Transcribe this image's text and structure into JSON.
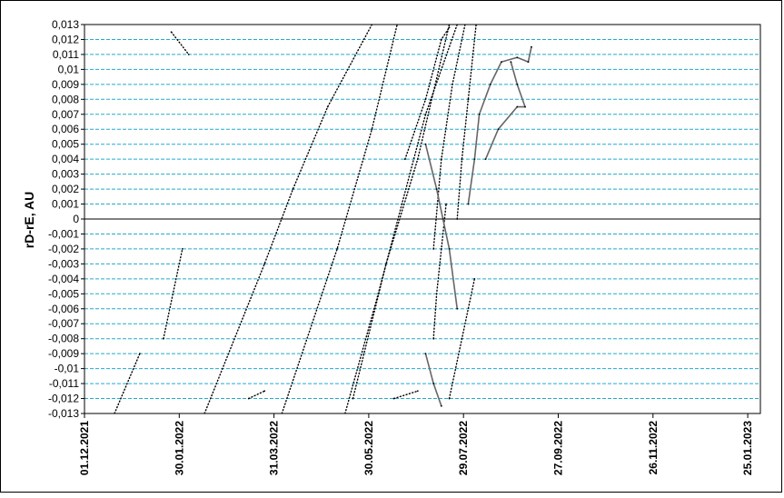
{
  "chart_data": {
    "type": "scatter",
    "title": "",
    "xlabel": "",
    "ylabel": "rD-rE, AU",
    "ylim": [
      -0.013,
      0.013
    ],
    "xlim": [
      "2021-12-01",
      "2023-02-02"
    ],
    "y_ticks": [
      "0,013",
      "0,012",
      "0,011",
      "0,01",
      "0,009",
      "0,008",
      "0,007",
      "0,006",
      "0,005",
      "0,004",
      "0,003",
      "0,002",
      "0,001",
      "0",
      "-0,001",
      "-0,002",
      "-0,003",
      "-0,004",
      "-0,005",
      "-0,006",
      "-0,007",
      "-0,008",
      "-0,009",
      "-0,01",
      "-0,011",
      "-0,012",
      "-0,013"
    ],
    "x_ticks": [
      {
        "date": "2021-12-01",
        "label": "01.12.2021"
      },
      {
        "date": "2022-01-30",
        "label": "30.01.2022"
      },
      {
        "date": "2022-03-31",
        "label": "31.03.2022"
      },
      {
        "date": "2022-05-30",
        "label": "30.05.2022"
      },
      {
        "date": "2022-07-29",
        "label": "29.07.2022"
      },
      {
        "date": "2022-09-27",
        "label": "27.09.2022"
      },
      {
        "date": "2022-11-26",
        "label": "26.11.2022"
      },
      {
        "date": "2023-01-25",
        "label": "25.01.2023"
      }
    ],
    "grid": "horizontal dashed",
    "legend": "none",
    "colors": {
      "grid": "#22aacc",
      "points": "#000000",
      "zero_line": "#000000",
      "curve": "#666666"
    },
    "series": [
      {
        "points": [
          [
            "2021-12-20",
            -0.013
          ],
          [
            "2022-01-05",
            -0.009
          ]
        ]
      },
      {
        "points": [
          [
            "2022-01-20",
            -0.008
          ],
          [
            "2022-02-01",
            -0.002
          ]
        ]
      },
      {
        "points": [
          [
            "2022-02-15",
            -0.013
          ],
          [
            "2022-03-25",
            -0.003
          ],
          [
            "2022-04-12",
            0.002
          ],
          [
            "2022-05-04",
            0.0075
          ],
          [
            "2022-06-01",
            0.013
          ]
        ]
      },
      {
        "points": [
          [
            "2022-04-05",
            -0.013
          ],
          [
            "2022-05-10",
            -0.002
          ],
          [
            "2022-06-01",
            0.006
          ],
          [
            "2022-06-17",
            0.013
          ]
        ]
      },
      {
        "points": [
          [
            "2022-05-15",
            -0.013
          ],
          [
            "2022-06-05",
            -0.005
          ],
          [
            "2022-06-20",
            0.001
          ],
          [
            "2022-07-05",
            0.007
          ],
          [
            "2022-07-25",
            0.013
          ]
        ]
      },
      {
        "points": [
          [
            "2022-05-20",
            -0.012
          ],
          [
            "2022-06-10",
            -0.003
          ],
          [
            "2022-06-30",
            0.004
          ],
          [
            "2022-07-20",
            0.013
          ]
        ]
      },
      {
        "points": [
          [
            "2022-06-22",
            0.004
          ],
          [
            "2022-07-05",
            0.008
          ],
          [
            "2022-07-15",
            0.012
          ],
          [
            "2022-07-20",
            0.0128
          ]
        ]
      },
      {
        "points": [
          [
            "2022-07-10",
            -0.002
          ],
          [
            "2022-07-15",
            0.004
          ],
          [
            "2022-07-22",
            0.009
          ],
          [
            "2022-07-30",
            0.013
          ]
        ]
      },
      {
        "points": [
          [
            "2022-07-25",
            0.0
          ],
          [
            "2022-07-28",
            0.004
          ],
          [
            "2022-08-01",
            0.008
          ],
          [
            "2022-08-06",
            0.013
          ]
        ]
      },
      {
        "points": [
          [
            "2022-06-15",
            -0.012
          ],
          [
            "2022-06-30",
            -0.0115
          ]
        ]
      },
      {
        "points": [
          [
            "2022-03-15",
            -0.012
          ],
          [
            "2022-03-25",
            -0.0115
          ]
        ]
      },
      {
        "points": [
          [
            "2022-01-25",
            0.0125
          ],
          [
            "2022-02-05",
            0.011
          ]
        ]
      },
      {
        "points": [
          [
            "2022-07-10",
            -0.008
          ],
          [
            "2022-07-12",
            -0.005
          ],
          [
            "2022-07-15",
            -0.002
          ],
          [
            "2022-07-18",
            0.001
          ]
        ]
      },
      {
        "points": [
          [
            "2022-07-20",
            -0.012
          ],
          [
            "2022-07-28",
            -0.008
          ],
          [
            "2022-08-05",
            -0.004
          ]
        ]
      },
      {
        "points": [
          [
            "2022-08-01",
            0.001
          ],
          [
            "2022-08-05",
            0.004
          ],
          [
            "2022-08-08",
            0.007
          ],
          [
            "2022-08-15",
            0.009
          ],
          [
            "2022-08-22",
            0.0105
          ],
          [
            "2022-09-01",
            0.0108
          ],
          [
            "2022-09-08",
            0.0105
          ],
          [
            "2022-09-10",
            0.0115
          ]
        ]
      },
      {
        "points": [
          [
            "2022-08-12",
            0.004
          ],
          [
            "2022-08-20",
            0.006
          ],
          [
            "2022-09-01",
            0.0075
          ],
          [
            "2022-09-06",
            0.0075
          ],
          [
            "2022-09-01",
            0.009
          ],
          [
            "2022-08-28",
            0.0105
          ]
        ]
      },
      {
        "points": [
          [
            "2022-07-05",
            0.005
          ],
          [
            "2022-07-12",
            0.002
          ],
          [
            "2022-07-20",
            -0.002
          ],
          [
            "2022-07-25",
            -0.006
          ]
        ]
      },
      {
        "points": [
          [
            "2022-07-05",
            -0.009
          ],
          [
            "2022-07-10",
            -0.011
          ],
          [
            "2022-07-15",
            -0.0125
          ]
        ]
      }
    ]
  }
}
